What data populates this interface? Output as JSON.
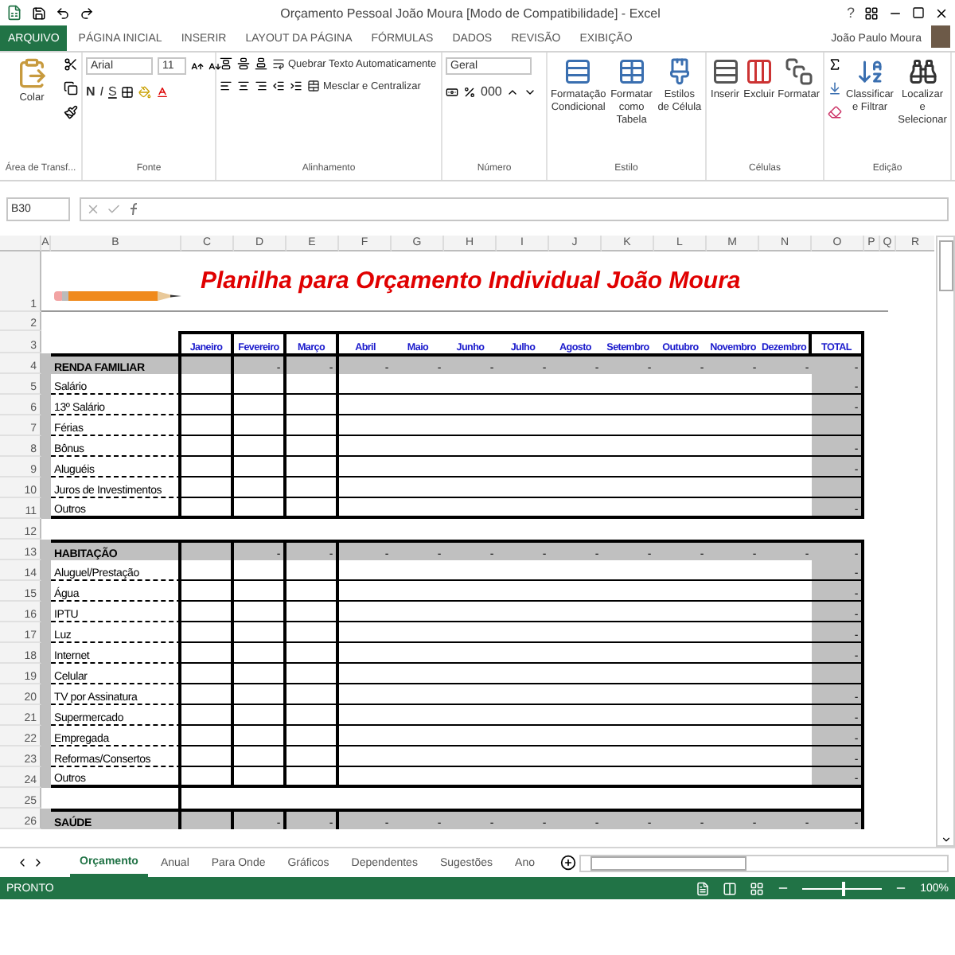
{
  "window": {
    "title": "Orçamento Pessoal João Moura [Modo de Compatibilidade] - Excel",
    "help": "?"
  },
  "ribbon": {
    "tabs": [
      {
        "label": "ARQUIVO",
        "selected": true
      },
      {
        "label": "PÁGINA INICIAL",
        "selected": false
      },
      {
        "label": "INSERIR",
        "selected": false
      },
      {
        "label": "LAYOUT DA PÁGINA",
        "selected": false
      },
      {
        "label": "FÓRMULAS",
        "selected": false
      },
      {
        "label": "DADOS",
        "selected": false
      },
      {
        "label": "REVISÃO",
        "selected": false
      },
      {
        "label": "EXIBIÇÃO",
        "selected": false
      }
    ],
    "user": "João Paulo Moura",
    "groups": [
      {
        "kind": "clipboard",
        "label": "Área de Transf...",
        "buttons": [
          "Colar"
        ]
      },
      {
        "kind": "font",
        "label": "Fonte",
        "font": "Arial",
        "size": "11",
        "styles": [
          "N",
          "I",
          "S"
        ]
      },
      {
        "kind": "alignment",
        "label": "Alinhamento",
        "buttons": [
          "Quebrar Texto Automaticamente",
          "Mesclar e Centralizar"
        ]
      },
      {
        "kind": "number",
        "label": "Número",
        "format": "Geral",
        "thousands": "000"
      },
      {
        "kind": "large",
        "label": "Estilo",
        "buttons": [
          "Formatação Condicional",
          "Formatar como Tabela",
          "Estilos de Célula"
        ]
      },
      {
        "kind": "large",
        "label": "Células",
        "buttons": [
          "Inserir",
          "Excluir",
          "Formatar"
        ]
      },
      {
        "kind": "editing",
        "label": "Edição",
        "buttons": [
          "Classificar e Filtrar",
          "Localizar e Selecionar"
        ]
      }
    ]
  },
  "formula_bar": {
    "name_box": "B30"
  },
  "sheet": {
    "columns": [
      "A",
      "B",
      "C",
      "D",
      "E",
      "F",
      "G",
      "H",
      "I",
      "J",
      "K",
      "L",
      "M",
      "N",
      "O",
      "P",
      "Q",
      "R"
    ],
    "title": "Planilha para Orçamento Individual João Moura",
    "months": [
      "Janeiro",
      "Fevereiro",
      "Março",
      "Abril",
      "Maio",
      "Junho",
      "Julho",
      "Agosto",
      "Setembro",
      "Outubro",
      "Novembro",
      "Dezembro",
      "TOTAL"
    ],
    "rows": [
      {
        "kind": "title",
        "number": "1"
      },
      {
        "kind": "blank",
        "number": "2"
      },
      {
        "kind": "header",
        "number": "3"
      },
      {
        "kind": "section",
        "number": "4",
        "label": "RENDA FAMILIAR",
        "values": [
          "-",
          "-",
          "-",
          "-",
          "-",
          "-",
          "-",
          "-",
          "-",
          "-",
          "-",
          "-"
        ]
      },
      {
        "kind": "item",
        "number": "5",
        "label": "Salário",
        "total": "-"
      },
      {
        "kind": "item",
        "number": "6",
        "label": "13º Salário",
        "total": "-"
      },
      {
        "kind": "item",
        "number": "7",
        "label": "Férias",
        "total": ""
      },
      {
        "kind": "item",
        "number": "8",
        "label": "Bônus",
        "total": "-"
      },
      {
        "kind": "item",
        "number": "9",
        "label": "Aluguéis",
        "total": "-"
      },
      {
        "kind": "item",
        "number": "10",
        "label": "Juros de Investimentos",
        "total": ""
      },
      {
        "kind": "item",
        "number": "11",
        "label": "Outros",
        "total": "-"
      },
      {
        "kind": "blank",
        "number": "12"
      },
      {
        "kind": "section",
        "number": "13",
        "label": "HABITAÇÃO",
        "values": [
          "-",
          "-",
          "-",
          "-",
          "-",
          "-",
          "-",
          "-",
          "-",
          "-",
          "-",
          "-"
        ]
      },
      {
        "kind": "item",
        "number": "14",
        "label": "Aluguel/Prestação",
        "total": "-"
      },
      {
        "kind": "item",
        "number": "15",
        "label": "Água",
        "total": "-"
      },
      {
        "kind": "item",
        "number": "16",
        "label": "IPTU",
        "total": "-"
      },
      {
        "kind": "item",
        "number": "17",
        "label": "Luz",
        "total": "-"
      },
      {
        "kind": "item",
        "number": "18",
        "label": "Internet",
        "total": "-"
      },
      {
        "kind": "item",
        "number": "19",
        "label": "Celular",
        "total": ""
      },
      {
        "kind": "item",
        "number": "20",
        "label": "TV por Assinatura",
        "total": "-"
      },
      {
        "kind": "item",
        "number": "21",
        "label": "Supermercado",
        "total": "-"
      },
      {
        "kind": "item",
        "number": "22",
        "label": "Empregada",
        "total": "-"
      },
      {
        "kind": "item",
        "number": "23",
        "label": "Reformas/Consertos",
        "total": "-"
      },
      {
        "kind": "item",
        "number": "24",
        "label": "Outros",
        "total": "-"
      },
      {
        "kind": "spacer",
        "number": "25"
      },
      {
        "kind": "section",
        "number": "26",
        "label": "SAÚDE",
        "values": [
          "-",
          "-",
          "-",
          "-",
          "-",
          "-",
          "-",
          "-",
          "-",
          "-",
          "-",
          "-"
        ]
      }
    ]
  },
  "sheet_tabs": [
    {
      "label": "Orçamento",
      "selected": true
    },
    {
      "label": "Anual",
      "selected": false
    },
    {
      "label": "Para Onde",
      "selected": false
    },
    {
      "label": "Gráficos",
      "selected": false
    },
    {
      "label": "Dependentes",
      "selected": false
    },
    {
      "label": "Sugestões",
      "selected": false
    },
    {
      "label": "Ano",
      "selected": false
    }
  ],
  "status_bar": {
    "status": "PRONTO",
    "zoom": "100%",
    "zoom_slider": {
      "level": 0.5
    }
  }
}
